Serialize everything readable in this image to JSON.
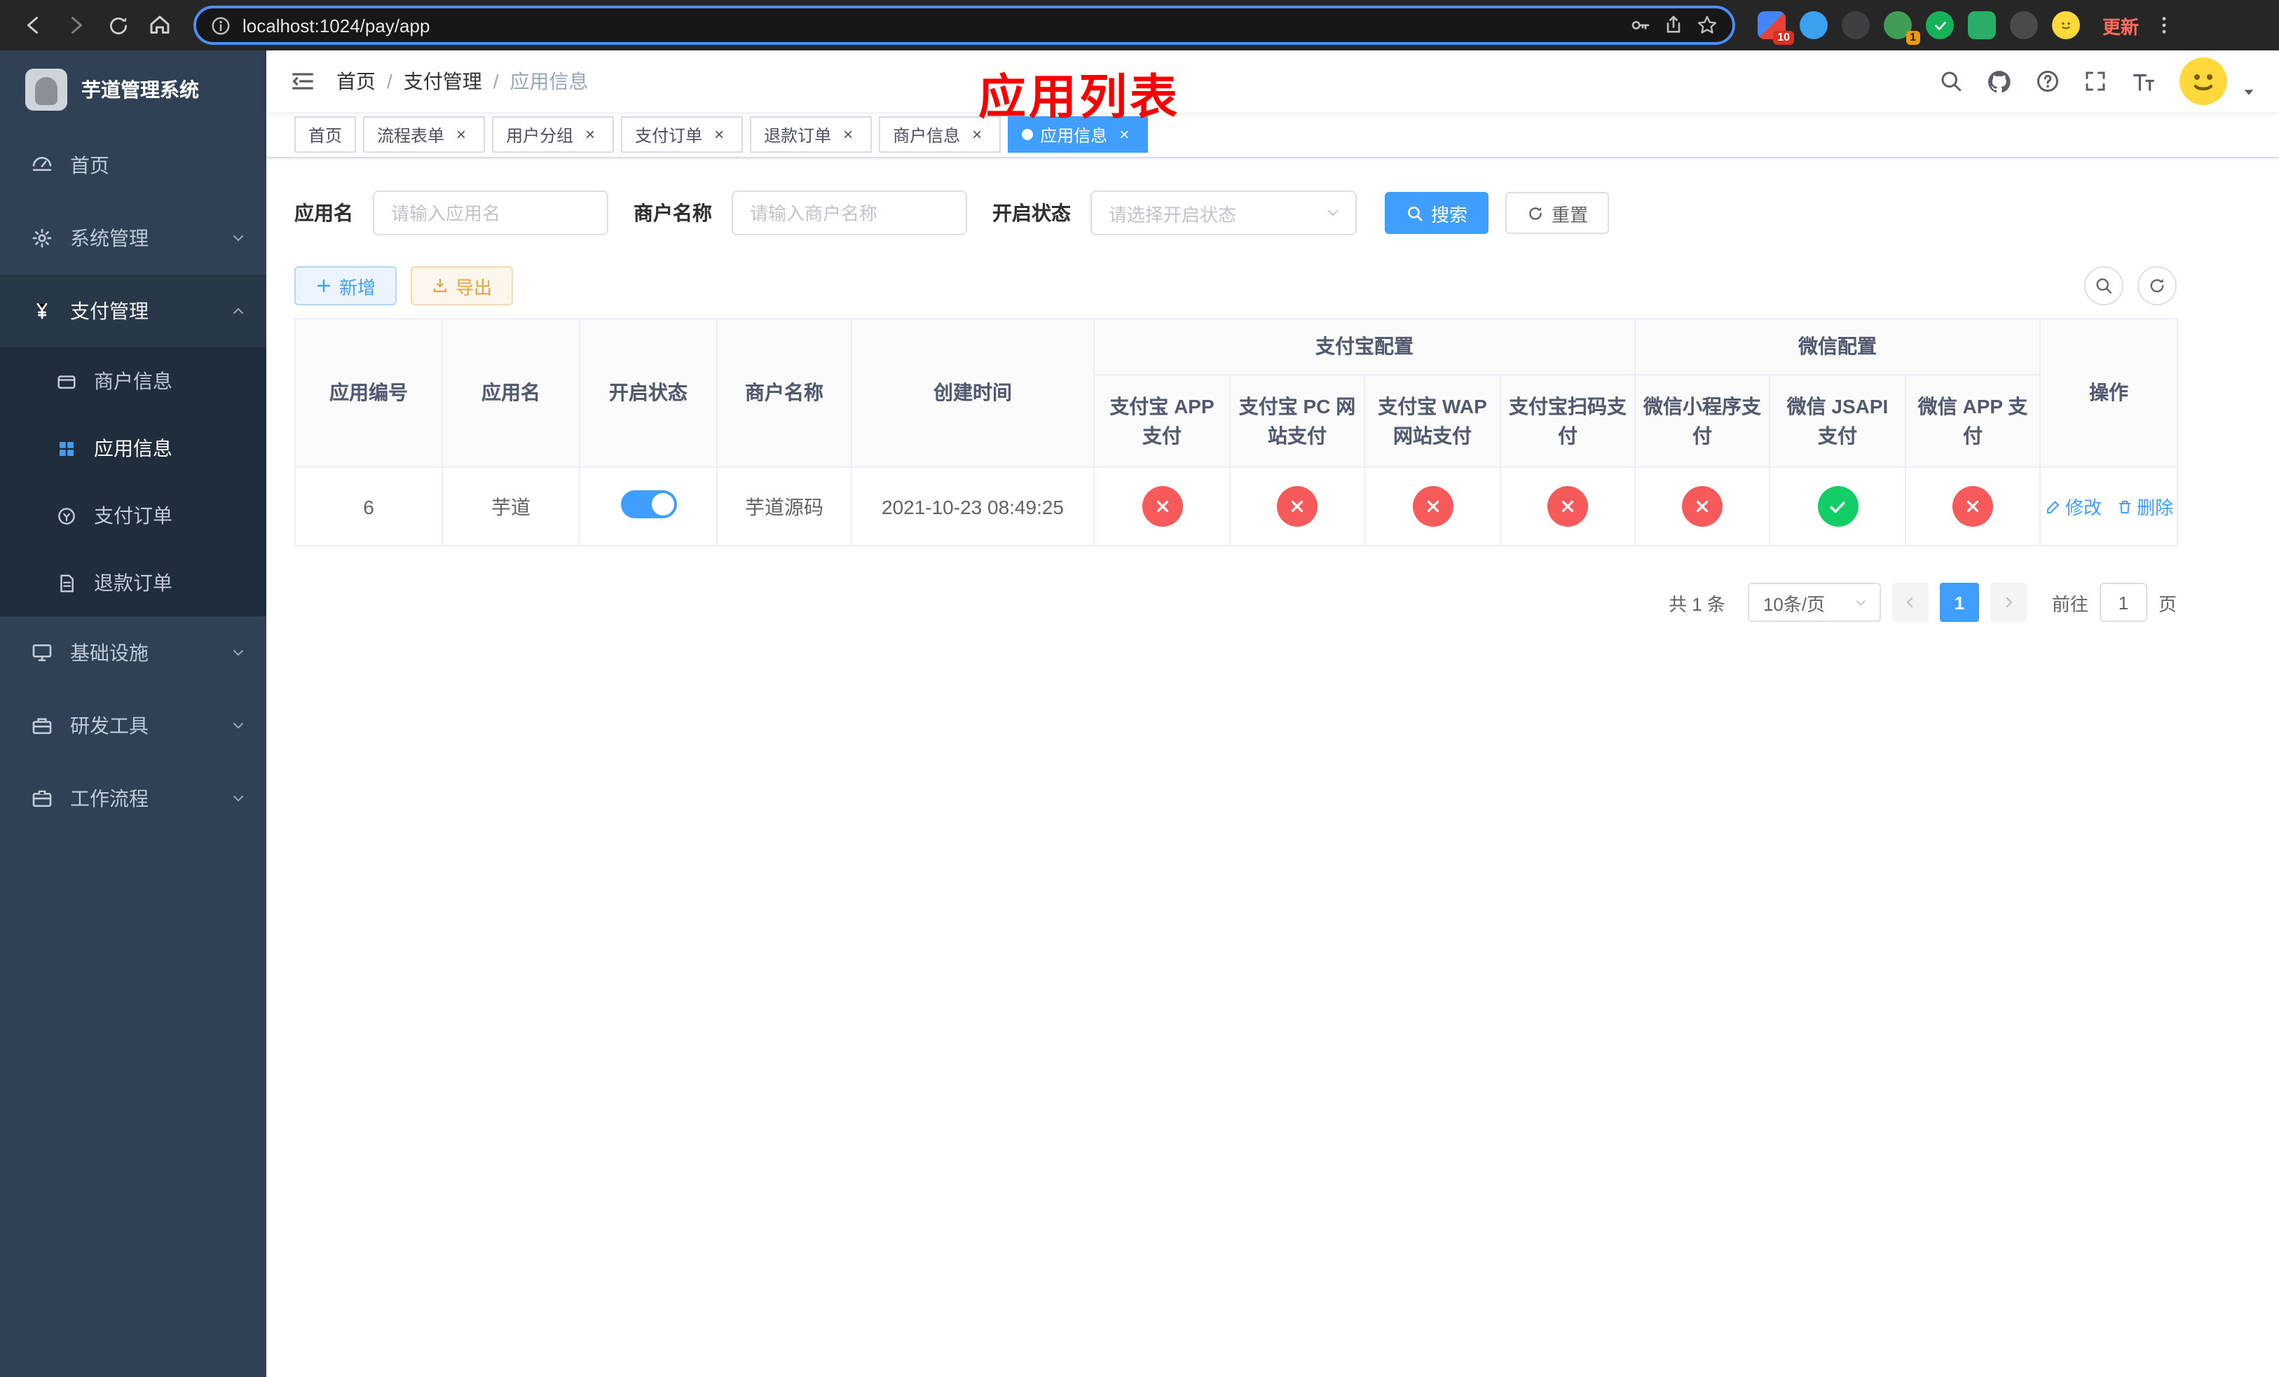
{
  "colors": {
    "primary": "#409eff",
    "success": "#13ce66",
    "danger": "#f65a5a",
    "warning": "#e6a23c",
    "annotation": "#f70000",
    "sidebar_bg": "#304156",
    "submenu_bg": "#1f2d3d"
  },
  "browser": {
    "url": "localhost:1024/pay/app",
    "update_label": "更新",
    "ext_badges": {
      "grid": "10",
      "avatar": "1"
    }
  },
  "overlay": {
    "title": "应用列表"
  },
  "sidebar": {
    "title": "芋道管理系统",
    "menu": {
      "home": "首页",
      "system": "系统管理",
      "pay": "支付管理",
      "infra": "基础设施",
      "devtools": "研发工具",
      "workflow": "工作流程"
    },
    "submenu": {
      "merchant": "商户信息",
      "app": "应用信息",
      "order": "支付订单",
      "refund": "退款订单"
    }
  },
  "navbar": {
    "breadcrumb": {
      "home": "首页",
      "section": "支付管理",
      "current": "应用信息"
    },
    "separator": "/"
  },
  "icons": {
    "close": "×"
  },
  "tabs": [
    {
      "label": "首页",
      "closable": false,
      "active": false
    },
    {
      "label": "流程表单",
      "closable": true,
      "active": false
    },
    {
      "label": "用户分组",
      "closable": true,
      "active": false
    },
    {
      "label": "支付订单",
      "closable": true,
      "active": false
    },
    {
      "label": "退款订单",
      "closable": true,
      "active": false
    },
    {
      "label": "商户信息",
      "closable": true,
      "active": false
    },
    {
      "label": "应用信息",
      "closable": true,
      "active": true
    }
  ],
  "filters": {
    "app_name_label": "应用名",
    "app_name_placeholder": "请输入应用名",
    "merchant_label": "商户名称",
    "merchant_placeholder": "请输入商户名称",
    "status_label": "开启状态",
    "status_placeholder": "请选择开启状态",
    "search_label": "搜索",
    "reset_label": "重置"
  },
  "toolbar": {
    "add_label": "新增",
    "export_label": "导出"
  },
  "table": {
    "headers": {
      "app_id": "应用编号",
      "app_name": "应用名",
      "status": "开启状态",
      "merchant": "商户名称",
      "create_time": "创建时间",
      "alipay_group": "支付宝配置",
      "alipay_app": "支付宝 APP 支付",
      "alipay_pc": "支付宝 PC 网站支付",
      "alipay_wap": "支付宝 WAP 网站支付",
      "alipay_qr": "支付宝扫码支付",
      "wechat_group": "微信配置",
      "wechat_mini": "微信小程序支付",
      "wechat_jsapi": "微信 JSAPI 支付",
      "wechat_app": "微信 APP 支付",
      "actions": "操作"
    },
    "row": {
      "app_id": "6",
      "app_name": "芋道",
      "enabled": true,
      "merchant": "芋道源码",
      "create_time": "2021-10-23 08:49:25",
      "alipay_app": "disabled",
      "alipay_pc": "disabled",
      "alipay_wap": "disabled",
      "alipay_qr": "disabled",
      "wechat_mini": "disabled",
      "wechat_jsapi": "enabled",
      "wechat_app": "disabled",
      "edit_label": "修改",
      "delete_label": "删除"
    }
  },
  "pagination": {
    "total_label": "共 1 条",
    "page_size_label": "10条/页",
    "current_page": "1",
    "goto_label": "前往",
    "goto_value": "1",
    "page_suffix": "页"
  }
}
